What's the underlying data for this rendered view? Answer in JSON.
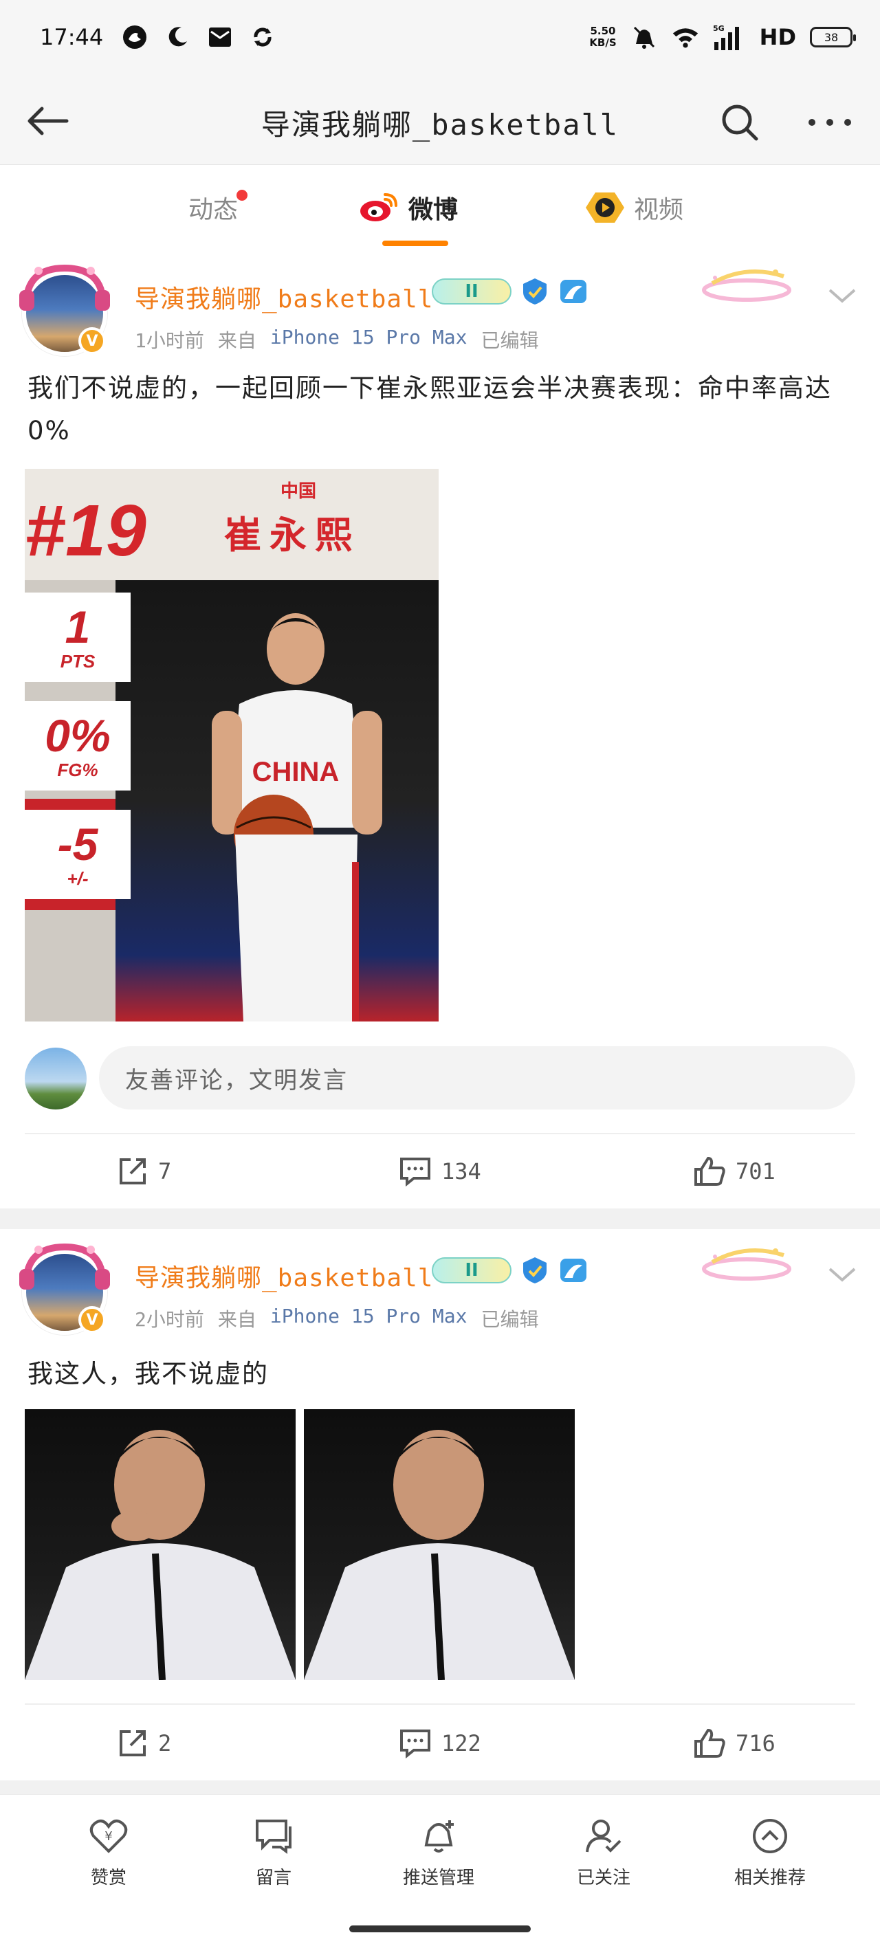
{
  "status_bar": {
    "time": "17:44",
    "net_speed_value": "5.50",
    "net_speed_unit": "KB/S",
    "network": "HD",
    "signal_label": "5G",
    "battery": "38"
  },
  "header": {
    "title": "导演我躺哪_basketball",
    "icons": [
      "back-arrow-icon",
      "search-icon",
      "more-dots-icon"
    ]
  },
  "tabs": [
    {
      "label": "动态",
      "has_dot": true,
      "active": false
    },
    {
      "label": "微博",
      "active": true
    },
    {
      "label": "视频",
      "active": false
    }
  ],
  "colors": {
    "accent": "#ff8200",
    "username": "#f07c1a",
    "device": "#5a78a8",
    "red_dot": "#f23a3a"
  },
  "posts": [
    {
      "username": "导演我躺哪_basketball",
      "level": "II",
      "time": "1小时前",
      "source_prefix": "来自",
      "device": "iPhone 15 Pro Max",
      "edited": "已编辑",
      "text": "我们不说虚的，一起回顾一下崔永熙亚运会半决赛表现：命中率高达0%",
      "image": {
        "number": "#19",
        "country": "中国",
        "player_name": "崔永熙",
        "jersey_text": "CHINA",
        "stats": [
          {
            "value": "1",
            "label": "PTS"
          },
          {
            "value": "0%",
            "label": "FG%"
          },
          {
            "value": "-5",
            "label": "+/-"
          }
        ]
      },
      "comment_placeholder": "友善评论，文明发言",
      "reposts": "7",
      "comments": "134",
      "likes": "701"
    },
    {
      "username": "导演我躺哪_basketball",
      "level": "II",
      "time": "2小时前",
      "source_prefix": "来自",
      "device": "iPhone 15 Pro Max",
      "edited": "已编辑",
      "text": "我这人，我不说虚的",
      "reposts": "2",
      "comments": "122",
      "likes": "716"
    }
  ],
  "bottom_bar": [
    {
      "label": "赞赏",
      "icon": "reward-heart-icon"
    },
    {
      "label": "留言",
      "icon": "message-icon"
    },
    {
      "label": "推送管理",
      "icon": "bell-plus-icon"
    },
    {
      "label": "已关注",
      "icon": "user-check-icon"
    },
    {
      "label": "相关推荐",
      "icon": "up-circle-icon"
    }
  ]
}
